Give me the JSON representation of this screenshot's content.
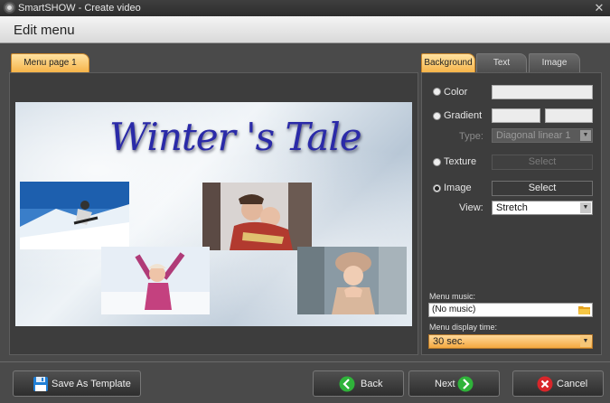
{
  "window": {
    "title": "SmartSHOW - Create video",
    "close_glyph": "✕",
    "app_icon": "film-reel-icon"
  },
  "header": {
    "title": "Edit menu"
  },
  "left": {
    "tab_label": "Menu page 1",
    "preview": {
      "menu_title": "Winter 's Tale"
    }
  },
  "right": {
    "tabs": [
      {
        "label": "Background",
        "active": true
      },
      {
        "label": "Text",
        "active": false
      },
      {
        "label": "Image",
        "active": false
      }
    ],
    "color_label": "Color",
    "gradient_label": "Gradient",
    "type_label": "Type:",
    "type_value": "Diagonal linear 1",
    "texture_label": "Texture",
    "texture_select": "Select",
    "image_label": "Image",
    "image_select": "Select",
    "view_label": "View:",
    "view_value": "Stretch",
    "music_label": "Menu music:",
    "music_value": "(No music)",
    "display_time_label": "Menu display time:",
    "display_time_value": "30 sec.",
    "colors": {
      "accent": "#f6b44a",
      "panel": "#3d3d3d"
    }
  },
  "footer": {
    "save_template": "Save As Template",
    "back": "Back",
    "next": "Next",
    "cancel": "Cancel"
  }
}
